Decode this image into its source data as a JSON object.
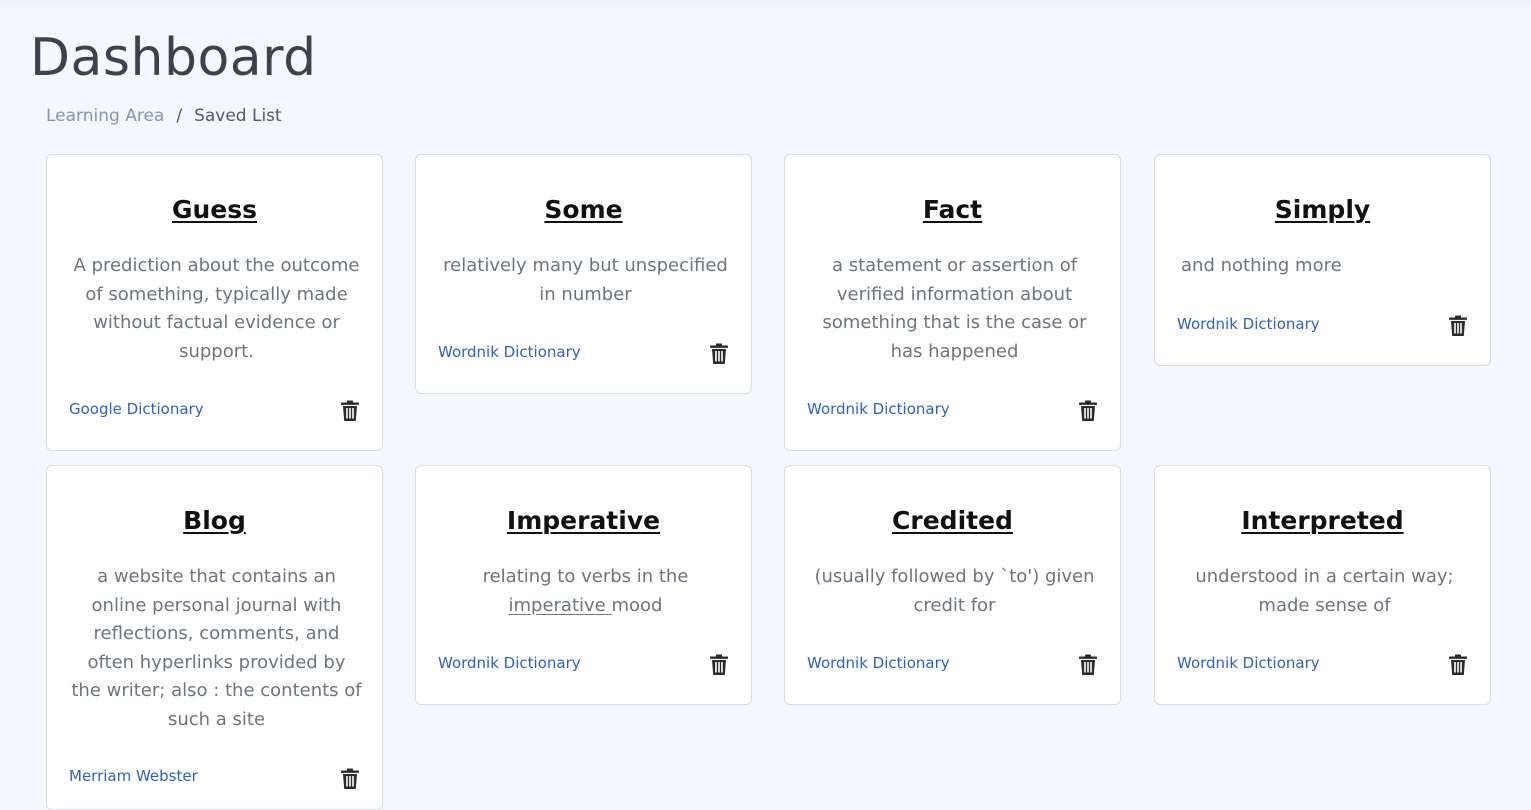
{
  "page": {
    "title": "Dashboard",
    "breadcrumb": {
      "parent": "Learning Area",
      "separator": "/",
      "current": "Saved List"
    }
  },
  "cards": [
    {
      "word": "Guess",
      "definition": "A prediction about the outcome of something, typically made without factual evidence or support.",
      "source": "Google Dictionary"
    },
    {
      "word": "Some",
      "definition": "relatively many but unspecified in number",
      "source": "Wordnik Dictionary"
    },
    {
      "word": "Fact",
      "definition": "a statement or assertion of verified information about something that is the case or has happened",
      "source": "Wordnik Dictionary"
    },
    {
      "word": "Simply",
      "definition": "and nothing more",
      "source": "Wordnik Dictionary"
    },
    {
      "word": "Blog",
      "definition": "a website that contains an online personal journal with reflections, comments, and often hyperlinks provided by the writer; also : the contents of such a site",
      "source": "Merriam Webster"
    },
    {
      "word": "Imperative",
      "definition_before": "relating to verbs in the ",
      "definition_link": "imperative ",
      "definition_after": "mood",
      "source": "Wordnik Dictionary"
    },
    {
      "word": "Credited",
      "definition": "(usually followed by `to') given credit for",
      "source": "Wordnik Dictionary"
    },
    {
      "word": "Interpreted",
      "definition": "understood in a certain way; made sense of",
      "source": "Wordnik Dictionary"
    }
  ],
  "icons": {
    "delete": "trash-icon"
  },
  "colors": {
    "background": "#f4f7fd",
    "source_link": "#2f5fc6",
    "title": "#3f4246"
  }
}
